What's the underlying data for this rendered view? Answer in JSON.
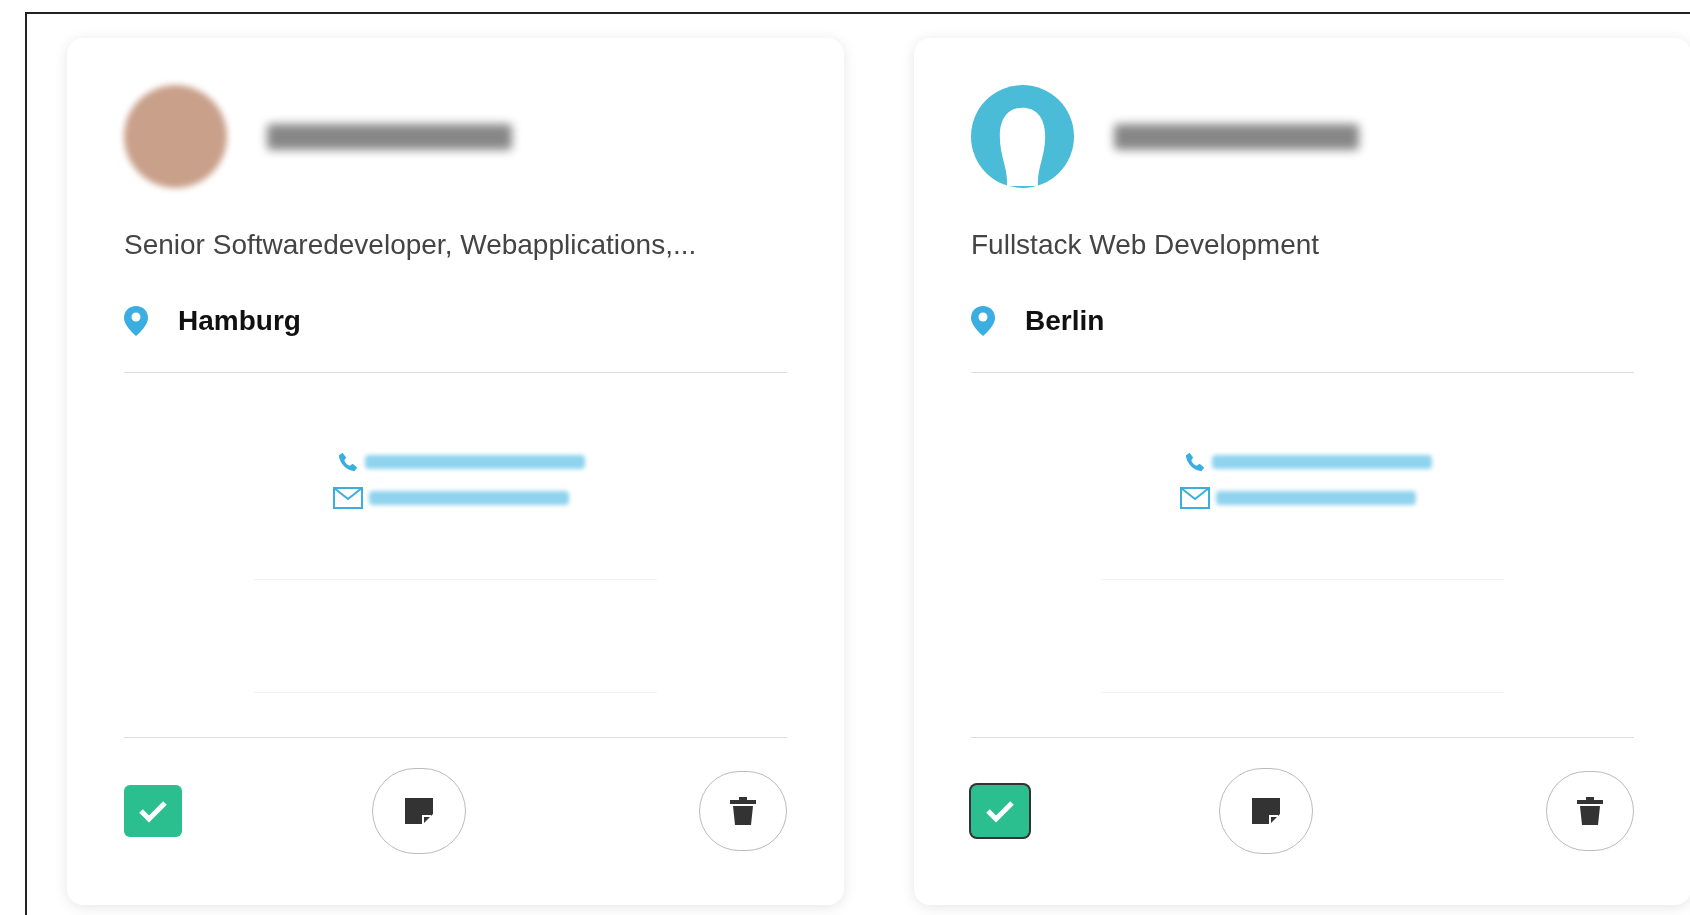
{
  "cards": [
    {
      "avatar": {
        "kind": "photo"
      },
      "title": "Senior Softwaredeveloper, Webapplications,...",
      "location": "Hamburg",
      "checked": true,
      "focused": false
    },
    {
      "avatar": {
        "kind": "silhouette"
      },
      "title": "Fullstack Web Development",
      "location": "Berlin",
      "checked": true,
      "focused": true
    }
  ]
}
